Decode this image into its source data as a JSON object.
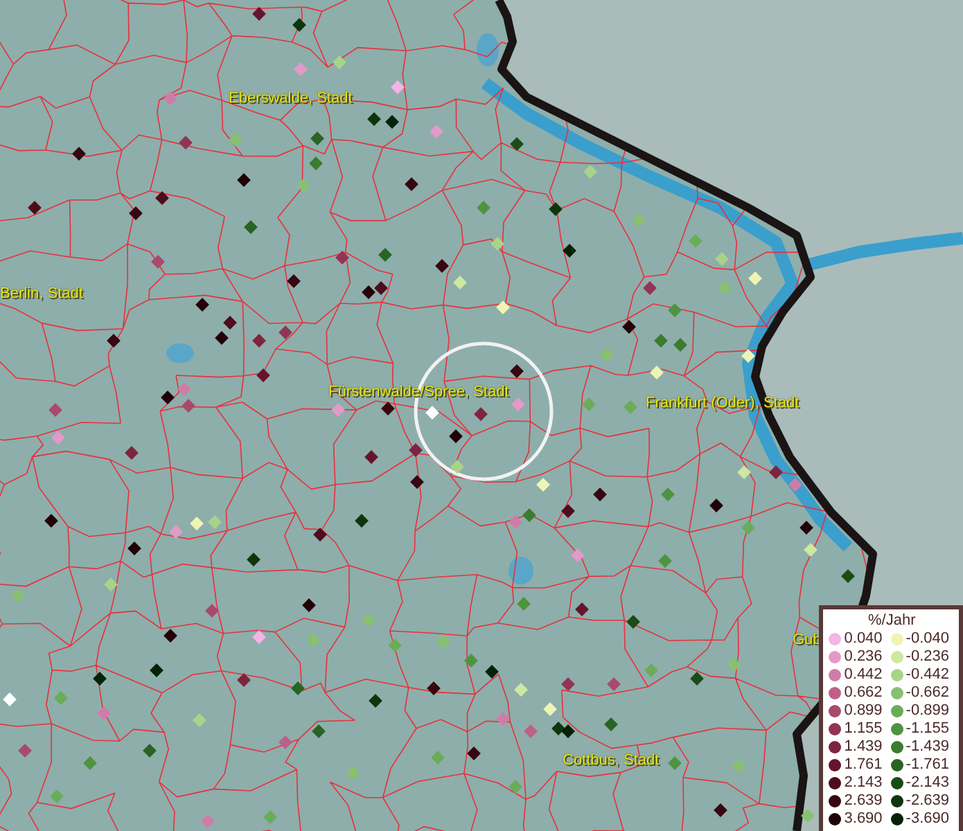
{
  "map": {
    "places": [
      {
        "name": "Eberswalde, Stadt"
      },
      {
        "name": "Berlin, Stadt"
      },
      {
        "name": "Fürstenwalde/Spree, Stadt"
      },
      {
        "name": "Frankfurt (Oder), Stadt"
      },
      {
        "name": "Cottbus, Stadt"
      },
      {
        "name": "Gub"
      }
    ]
  },
  "legend": {
    "title": "%/Jahr",
    "positive": [
      {
        "label": "0.040",
        "color": "#f5b3e6"
      },
      {
        "label": "0.236",
        "color": "#e39ac8"
      },
      {
        "label": "0.442",
        "color": "#d07ca8"
      },
      {
        "label": "0.662",
        "color": "#bd6088"
      },
      {
        "label": "0.899",
        "color": "#a84a6c"
      },
      {
        "label": "1.155",
        "color": "#933455"
      },
      {
        "label": "1.439",
        "color": "#7e2440"
      },
      {
        "label": "1.761",
        "color": "#66142c"
      },
      {
        "label": "2.143",
        "color": "#4e0c1c"
      },
      {
        "label": "2.639",
        "color": "#380610"
      },
      {
        "label": "3.690",
        "color": "#220008"
      }
    ],
    "negative": [
      {
        "label": "-0.040",
        "color": "#eef5b4"
      },
      {
        "label": "-0.236",
        "color": "#cde8a0"
      },
      {
        "label": "-0.442",
        "color": "#a8d488"
      },
      {
        "label": "-0.662",
        "color": "#88c070"
      },
      {
        "label": "-0.899",
        "color": "#6aac58"
      },
      {
        "label": "-1.155",
        "color": "#4e9440"
      },
      {
        "label": "-1.439",
        "color": "#3a7c30"
      },
      {
        "label": "-1.761",
        "color": "#286422"
      },
      {
        "label": "-2.143",
        "color": "#1a4c16"
      },
      {
        "label": "-2.639",
        "color": "#0e360c"
      },
      {
        "label": "-3.690",
        "color": "#062206"
      }
    ]
  }
}
